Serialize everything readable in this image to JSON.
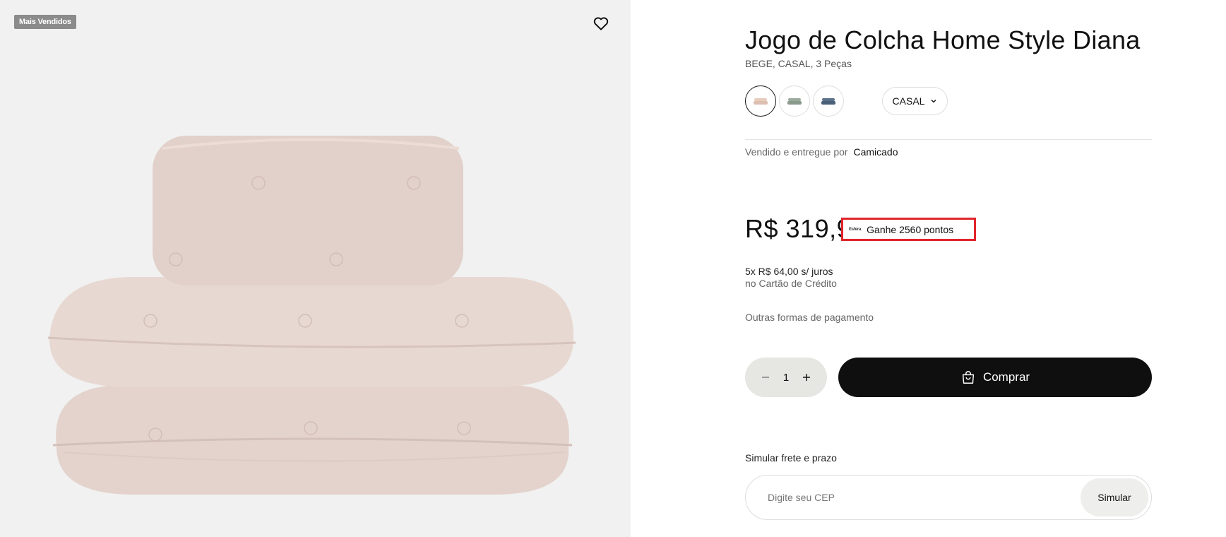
{
  "gallery": {
    "badge": "Mais Vendidos",
    "favorite_icon": "heart-outline-icon",
    "image_alt": "pillows-and-quilt-stack"
  },
  "product": {
    "title": "Jogo de Colcha Home Style Diana",
    "subtitle": "BEGE, CASAL, 3 Peças",
    "swatches": [
      {
        "name": "bege",
        "color": "#e7cbbd",
        "selected": true
      },
      {
        "name": "verde",
        "color": "#8a9a8c",
        "selected": false
      },
      {
        "name": "azul",
        "color": "#4a5f78",
        "selected": false
      }
    ],
    "size": {
      "selected": "CASAL",
      "icon": "chevron-down-icon"
    }
  },
  "seller": {
    "prefix": "Vendido e entregue por",
    "name": "Camicado"
  },
  "pricing": {
    "price": "R$ 319,99",
    "points_logo": "Esfera",
    "points_text": "Ganhe 2560 pontos",
    "installment_line1": "5x R$ 64,00 s/ juros",
    "installment_line2": "no Cartão de Crédito",
    "other_payment": "Outras formas de pagamento"
  },
  "purchase": {
    "quantity": "1",
    "minus_icon": "minus-icon",
    "plus_icon": "plus-icon",
    "buy_label": "Comprar",
    "buy_icon": "shopping-bag-icon"
  },
  "shipping": {
    "label": "Simular frete e prazo",
    "cep_placeholder": "Digite seu CEP",
    "simulate_label": "Simular"
  },
  "colors": {
    "primary_button": "#0f0f0f",
    "points_border": "#e0252a",
    "image_background": "#f1f1f1"
  }
}
